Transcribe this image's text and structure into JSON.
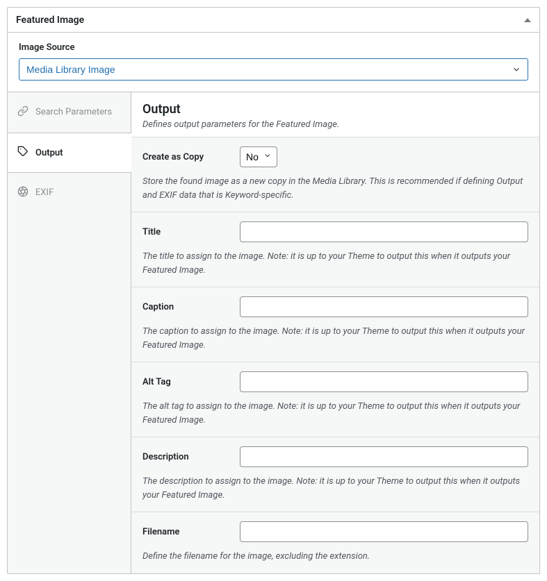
{
  "header": {
    "title": "Featured Image"
  },
  "source": {
    "label": "Image Source",
    "selected": "Media Library Image"
  },
  "tabs": {
    "items": [
      {
        "label": "Search Parameters",
        "icon": "link-icon"
      },
      {
        "label": "Output",
        "icon": "tag-icon"
      },
      {
        "label": "EXIF",
        "icon": "aperture-icon"
      }
    ],
    "active": 1
  },
  "panel": {
    "heading": "Output",
    "description": "Defines output parameters for the Featured Image.",
    "fields": [
      {
        "key": "create_as_copy",
        "label": "Create as Copy",
        "type": "select",
        "value": "No",
        "help": "Store the found image as a new copy in the Media Library. This is recommended if defining Output and EXIF data that is Keyword-specific."
      },
      {
        "key": "title",
        "label": "Title",
        "type": "text",
        "value": "",
        "help": "The title to assign to the image. Note: it is up to your Theme to output this when it outputs your Featured Image."
      },
      {
        "key": "caption",
        "label": "Caption",
        "type": "text",
        "value": "",
        "help": "The caption to assign to the image. Note: it is up to your Theme to output this when it outputs your Featured Image."
      },
      {
        "key": "alt_tag",
        "label": "Alt Tag",
        "type": "text",
        "value": "",
        "help": "The alt tag to assign to the image. Note: it is up to your Theme to output this when it outputs your Featured Image."
      },
      {
        "key": "description",
        "label": "Description",
        "type": "text",
        "value": "",
        "help": "The description to assign to the image. Note: it is up to your Theme to output this when it outputs your Featured Image."
      },
      {
        "key": "filename",
        "label": "Filename",
        "type": "text",
        "value": "",
        "help": "Define the filename for the image, excluding the extension."
      }
    ]
  }
}
